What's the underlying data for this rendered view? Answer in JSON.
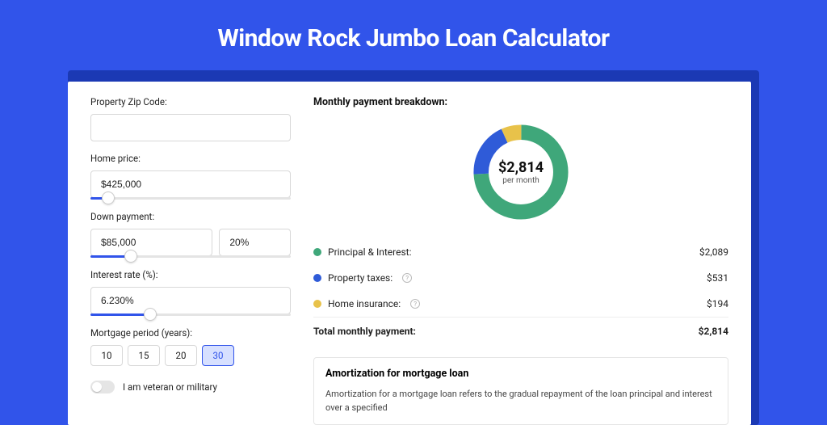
{
  "title": "Window Rock Jumbo Loan Calculator",
  "form": {
    "zip": {
      "label": "Property Zip Code:",
      "value": ""
    },
    "home": {
      "label": "Home price:",
      "value": "$425,000",
      "slider_pct": 9
    },
    "down": {
      "label": "Down payment:",
      "amount": "$85,000",
      "percent": "20%",
      "slider_pct": 20
    },
    "rate": {
      "label": "Interest rate (%):",
      "value": "6.230%",
      "slider_pct": 30
    },
    "period": {
      "label": "Mortgage period (years):",
      "options": [
        "10",
        "15",
        "20",
        "30"
      ],
      "active": "30"
    },
    "veteran": {
      "label": "I am veteran or military",
      "on": false
    }
  },
  "breakdown": {
    "title": "Monthly payment breakdown:",
    "center_amount": "$2,814",
    "center_sub": "per month",
    "rows": [
      {
        "label": "Principal & Interest:",
        "value": "$2,089",
        "color": "#3fa77a",
        "info": false
      },
      {
        "label": "Property taxes:",
        "value": "$531",
        "color": "#2f5bd8",
        "info": true
      },
      {
        "label": "Home insurance:",
        "value": "$194",
        "color": "#e8c24a",
        "info": true
      }
    ],
    "total": {
      "label": "Total monthly payment:",
      "value": "$2,814"
    }
  },
  "amortization": {
    "title": "Amortization for mortgage loan",
    "text": "Amortization for a mortgage loan refers to the gradual repayment of the loan principal and interest over a specified"
  },
  "chart_data": {
    "type": "pie",
    "title": "Monthly payment breakdown",
    "series": [
      {
        "name": "Principal & Interest",
        "value": 2089,
        "color": "#3fa77a"
      },
      {
        "name": "Property taxes",
        "value": 531,
        "color": "#2f5bd8"
      },
      {
        "name": "Home insurance",
        "value": 194,
        "color": "#e8c24a"
      }
    ],
    "total": 2814,
    "unit": "USD per month"
  }
}
